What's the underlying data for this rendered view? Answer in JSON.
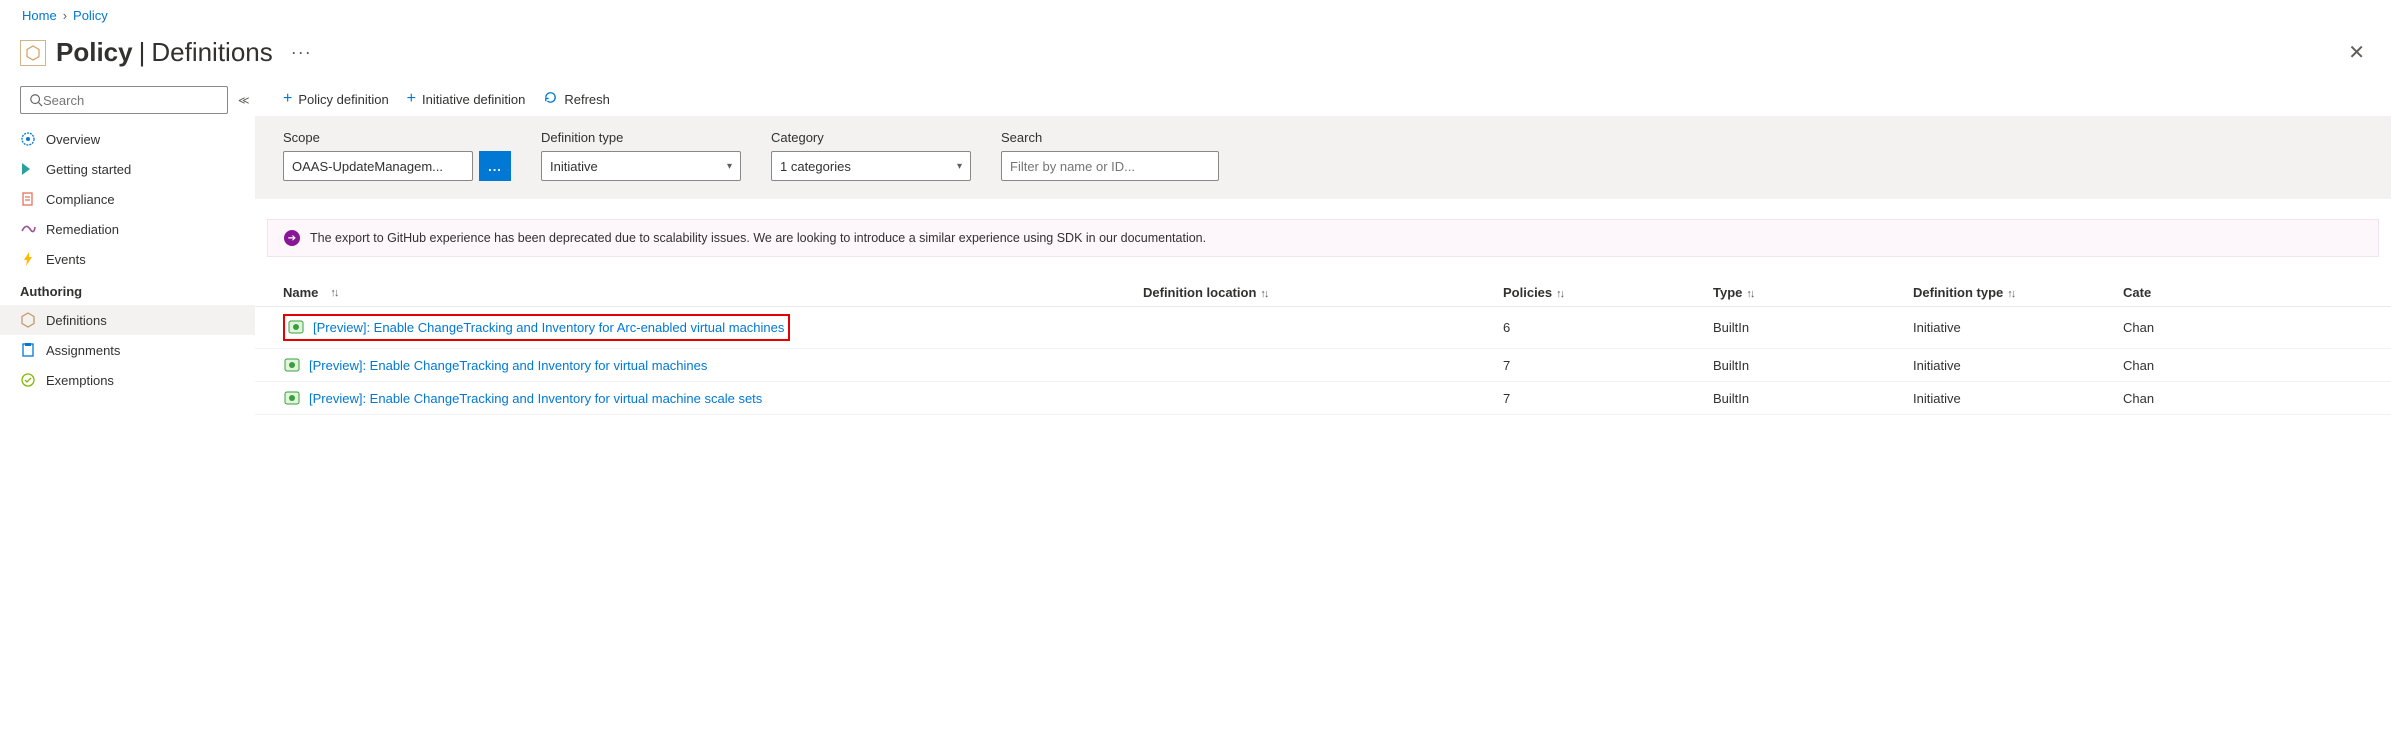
{
  "breadcrumb": {
    "home": "Home",
    "current": "Policy"
  },
  "header": {
    "title_strong": "Policy",
    "title_sep": "|",
    "title_light": "Definitions",
    "ellipsis": "···",
    "close": "✕"
  },
  "sidebar": {
    "search_placeholder": "Search",
    "collapse": "≪",
    "items_top": [
      {
        "label": "Overview",
        "icon": "overview-icon"
      },
      {
        "label": "Getting started",
        "icon": "getting-started-icon"
      },
      {
        "label": "Compliance",
        "icon": "compliance-icon"
      },
      {
        "label": "Remediation",
        "icon": "remediation-icon"
      },
      {
        "label": "Events",
        "icon": "events-icon"
      }
    ],
    "section_authoring": "Authoring",
    "items_auth": [
      {
        "label": "Definitions",
        "icon": "definitions-icon",
        "selected": true
      },
      {
        "label": "Assignments",
        "icon": "assignments-icon"
      },
      {
        "label": "Exemptions",
        "icon": "exemptions-icon"
      }
    ]
  },
  "toolbar": {
    "policy_def": "Policy definition",
    "initiative_def": "Initiative definition",
    "refresh": "Refresh"
  },
  "filters": {
    "scope_label": "Scope",
    "scope_value": "OAAS-UpdateManagem...",
    "scope_btn": "...",
    "deftype_label": "Definition type",
    "deftype_value": "Initiative",
    "category_label": "Category",
    "category_value": "1 categories",
    "search_label": "Search",
    "search_placeholder": "Filter by name or ID..."
  },
  "banner": {
    "text": "The export to GitHub experience has been deprecated due to scalability issues. We are looking to introduce a similar experience using SDK in our documentation."
  },
  "table": {
    "headers": {
      "name": "Name",
      "location": "Definition location",
      "policies": "Policies",
      "type": "Type",
      "deftype": "Definition type",
      "category": "Cate"
    },
    "rows": [
      {
        "name": "[Preview]: Enable ChangeTracking and Inventory for Arc-enabled virtual machines",
        "location": "",
        "policies": "6",
        "type": "BuiltIn",
        "deftype": "Initiative",
        "category": "Chan",
        "highlighted": true
      },
      {
        "name": "[Preview]: Enable ChangeTracking and Inventory for virtual machines",
        "location": "",
        "policies": "7",
        "type": "BuiltIn",
        "deftype": "Initiative",
        "category": "Chan"
      },
      {
        "name": "[Preview]: Enable ChangeTracking and Inventory for virtual machine scale sets",
        "location": "",
        "policies": "7",
        "type": "BuiltIn",
        "deftype": "Initiative",
        "category": "Chan"
      }
    ]
  }
}
